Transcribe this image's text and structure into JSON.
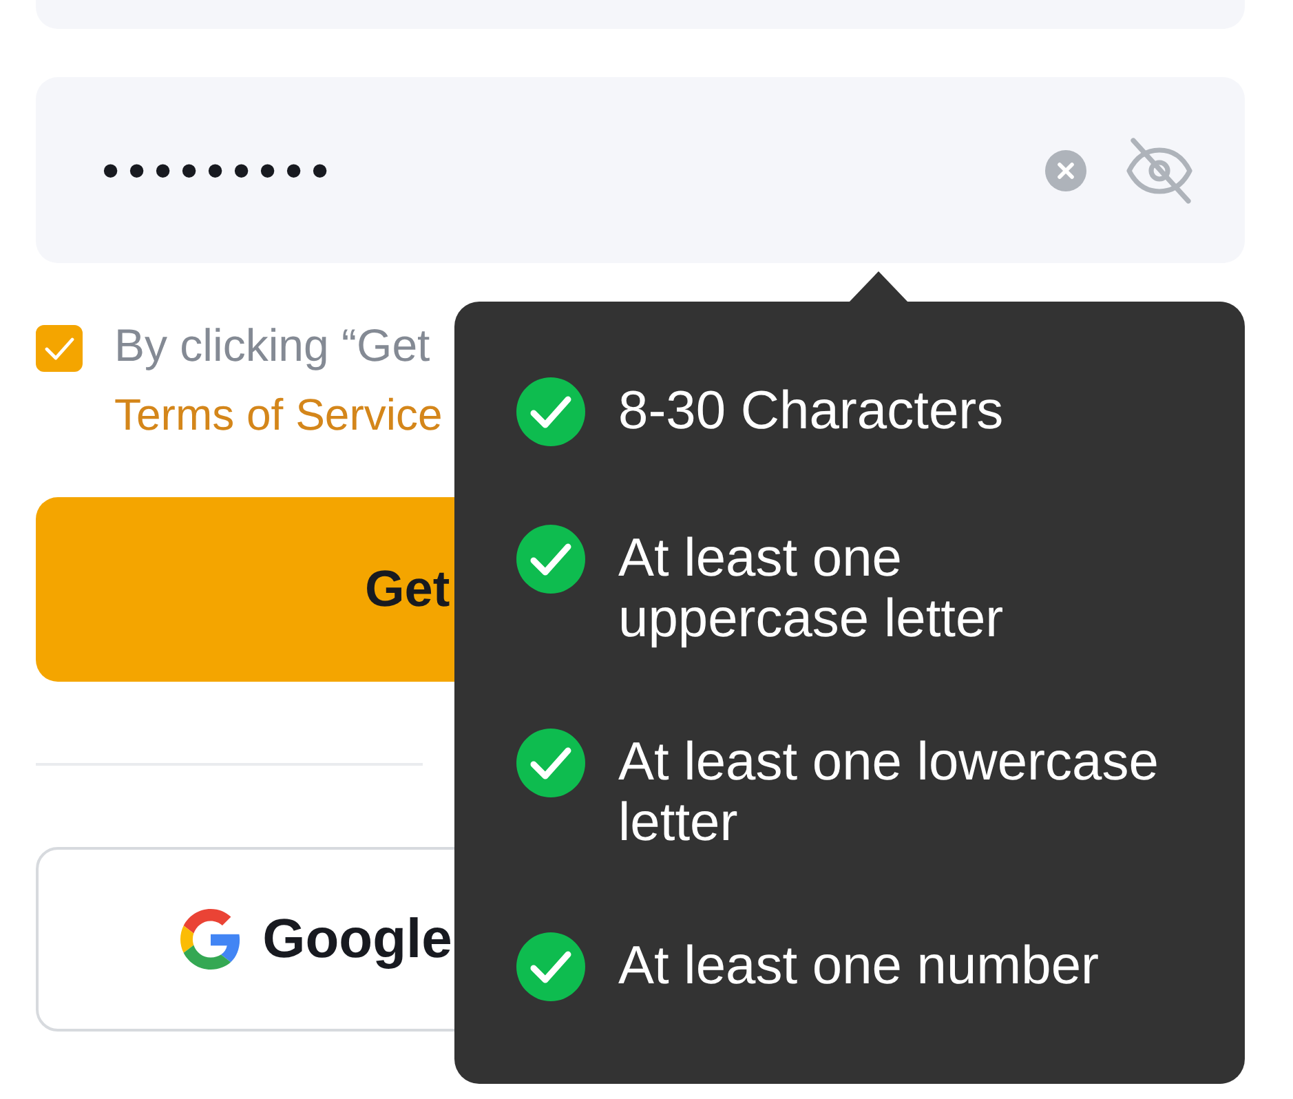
{
  "password_field": {
    "value": "•••••••••",
    "masked": true
  },
  "consent": {
    "checked": true,
    "text": "By clicking “Get",
    "link": "Terms of Service"
  },
  "primary_button": {
    "label": "Get"
  },
  "social_buttons": [
    {
      "kind": "google",
      "label": "Google"
    }
  ],
  "password_requirements": [
    {
      "text": "8-30 Characters",
      "met": true
    },
    {
      "text": "At least one\nuppercase letter",
      "met": true
    },
    {
      "text": "At least one lowercase\nletter",
      "met": true
    },
    {
      "text": "At least one number",
      "met": true
    }
  ]
}
